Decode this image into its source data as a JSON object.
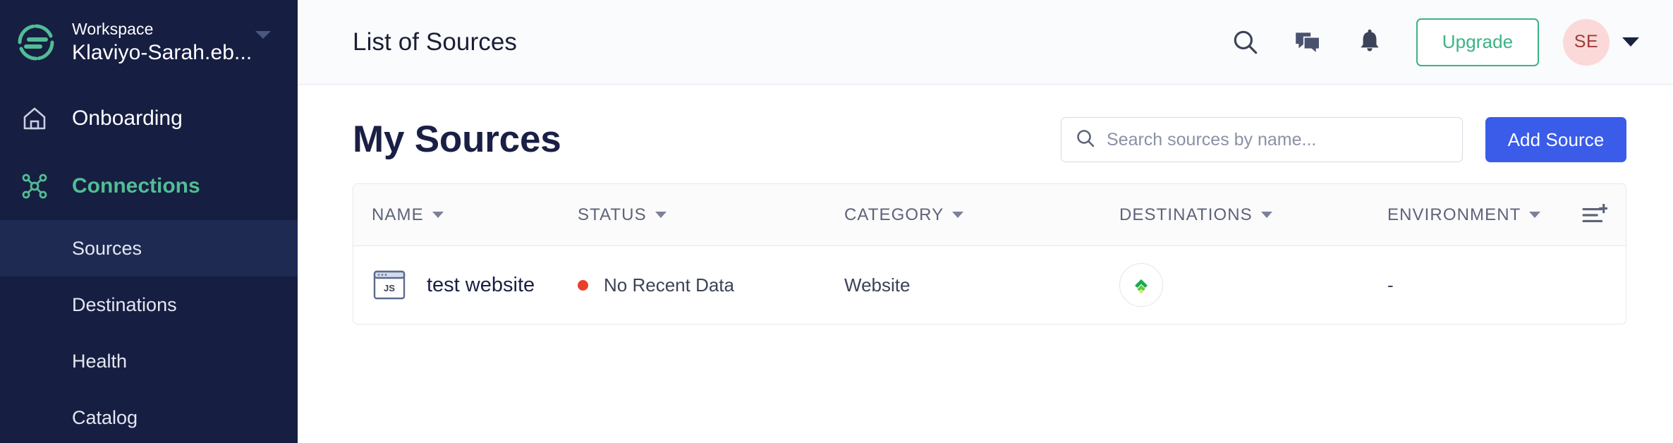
{
  "sidebar": {
    "logo_icon": "segment-logo-icon",
    "workspace_label": "Workspace",
    "workspace_name": "Klaviyo-Sarah.eb...",
    "workspace_caret_icon": "chevron-down-icon",
    "main_items": [
      {
        "label": "Onboarding",
        "icon": "home-icon",
        "state": "default"
      },
      {
        "label": "Connections",
        "icon": "connections-nodes-icon",
        "state": "active"
      }
    ],
    "sub_items": [
      {
        "label": "Sources",
        "active": true
      },
      {
        "label": "Destinations",
        "active": false
      },
      {
        "label": "Health",
        "active": false
      },
      {
        "label": "Catalog",
        "active": false
      }
    ]
  },
  "topbar": {
    "title": "List of Sources",
    "icons": [
      {
        "name": "search-icon"
      },
      {
        "name": "chat-message-icon"
      },
      {
        "name": "bell-notification-icon"
      }
    ],
    "upgrade_label": "Upgrade",
    "avatar_initials": "SE",
    "avatar_caret_icon": "chevron-down-icon"
  },
  "content": {
    "page_title": "My Sources",
    "search": {
      "placeholder": "Search sources by name...",
      "value": "",
      "icon": "search-icon"
    },
    "add_source_label": "Add Source"
  },
  "table": {
    "columns": [
      {
        "label": "NAME",
        "sortable": true
      },
      {
        "label": "STATUS",
        "sortable": true
      },
      {
        "label": "CATEGORY",
        "sortable": true
      },
      {
        "label": "DESTINATIONS",
        "sortable": true
      },
      {
        "label": "ENVIRONMENT",
        "sortable": true
      }
    ],
    "settings_icon": "column-settings-add-icon",
    "rows": [
      {
        "name": "test website",
        "source_icon": "javascript-website-icon",
        "status": "No Recent Data",
        "status_color": "#e8402a",
        "category": "Website",
        "destination_icon": "klaviyo-signal-icon",
        "environment": "-"
      }
    ]
  },
  "colors": {
    "sidebar_bg": "#161e42",
    "sidebar_active": "#1e2a52",
    "brand_green": "#52bd94",
    "upgrade_green": "#3bb385",
    "primary_blue": "#3a5ce9",
    "status_red": "#e8402a",
    "avatar_bg": "#fbd9d8",
    "text_dark": "#1a1f45"
  }
}
